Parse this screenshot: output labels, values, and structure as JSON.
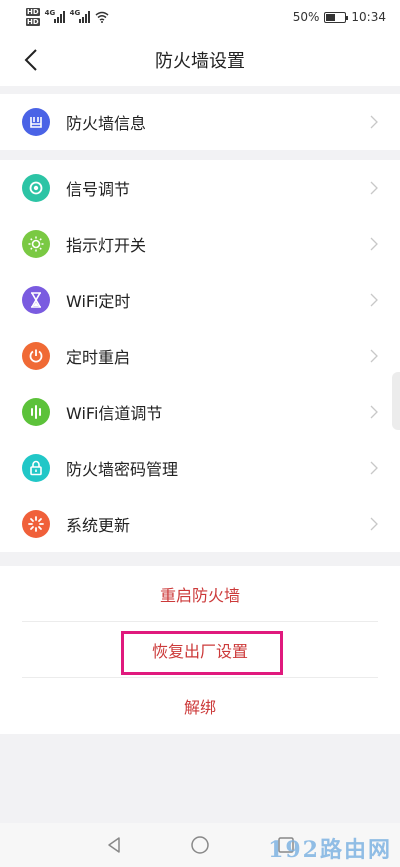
{
  "status_bar": {
    "hd": "HD",
    "net1": "4G",
    "net2": "4G",
    "battery_text": "50%",
    "battery_level": 0.5,
    "time": "10:34"
  },
  "header": {
    "title": "防火墙设置",
    "back_icon": "chevron-left-icon"
  },
  "group_info": {
    "items": [
      {
        "label": "防火墙信息",
        "icon": "firewall-info-icon",
        "color": "#4a63e6"
      }
    ]
  },
  "group_settings": {
    "items": [
      {
        "label": "信号调节",
        "icon": "signal-adjust-icon",
        "color": "#2cc4a5"
      },
      {
        "label": "指示灯开关",
        "icon": "indicator-light-icon",
        "color": "#7ac943"
      },
      {
        "label": "WiFi定时",
        "icon": "hourglass-icon",
        "color": "#7a5be0"
      },
      {
        "label": "定时重启",
        "icon": "power-icon",
        "color": "#f06a35"
      },
      {
        "label": "WiFi信道调节",
        "icon": "channel-bars-icon",
        "color": "#5cc23a"
      },
      {
        "label": "防火墙密码管理",
        "icon": "lock-icon",
        "color": "#21c7c7"
      },
      {
        "label": "系统更新",
        "icon": "update-spinner-icon",
        "color": "#f0603a"
      }
    ]
  },
  "actions": {
    "restart": "重启防火墙",
    "factory_reset": "恢复出厂设置",
    "unbind": "解绑",
    "color": "#cc3a3a",
    "highlight_color": "#e0197d"
  },
  "watermark": "192路由网"
}
